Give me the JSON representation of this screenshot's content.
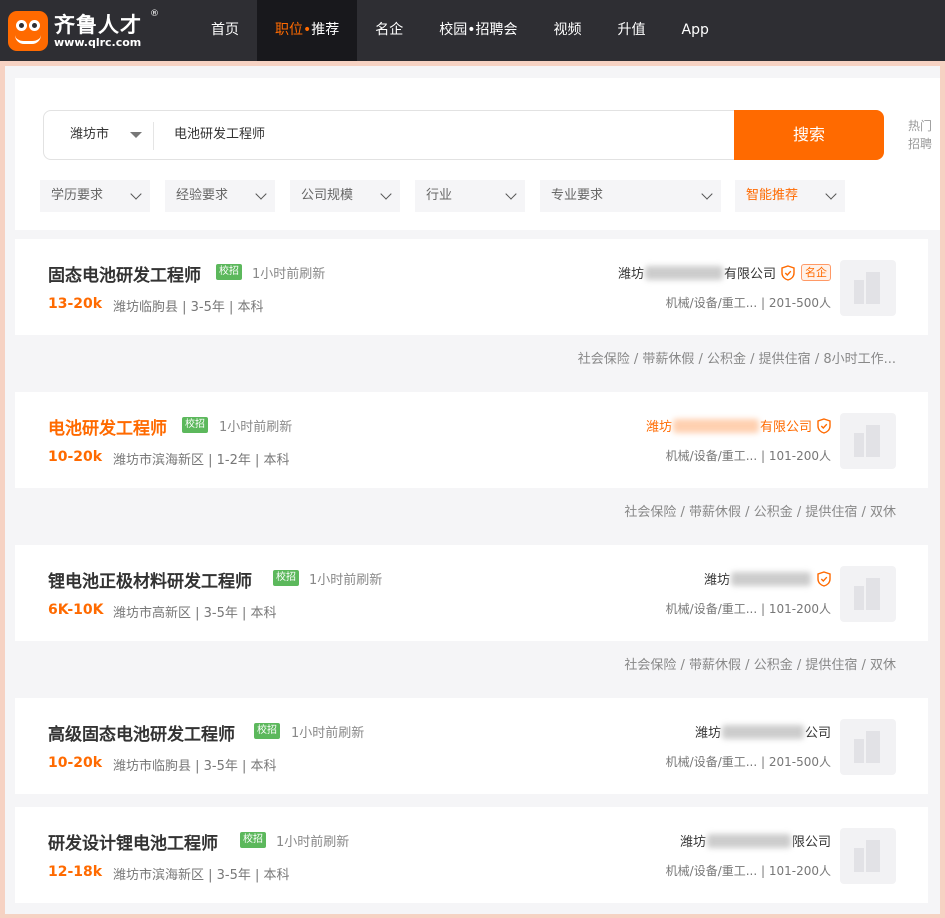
{
  "brand": {
    "name": "齐鲁人才",
    "reg": "®",
    "url": "www.qlrc.com"
  },
  "nav": [
    {
      "label": "首页"
    },
    {
      "label": "职位",
      "sep": "•",
      "second": "推荐",
      "active": true
    },
    {
      "label": "名企"
    },
    {
      "label": "校园•招聘会"
    },
    {
      "label": "视频"
    },
    {
      "label": "升值"
    },
    {
      "label": "App"
    }
  ],
  "search": {
    "city": "潍坊市",
    "keyword": "电池研发工程师",
    "button": "搜索",
    "hot_line1": "热门",
    "hot_line2": "招聘"
  },
  "filters": [
    "学历要求",
    "经验要求",
    "公司规模",
    "行业",
    "专业要求",
    "智能推荐"
  ],
  "jobs": [
    {
      "title": "固态电池研发工程师",
      "badge": "校招",
      "refresh": "1小时前刷新",
      "salary": "13-20k",
      "meta": "潍坊临朐县  |  3-5年  |  本科",
      "company_prefix": "潍坊",
      "company_suffix": "有限公司",
      "famous": "名企",
      "company_info": "机械/设备/重工...  | 201-500人",
      "welfare": "社会保险 / 带薪休假 / 公积金 / 提供住宿 / 8小时工作..."
    },
    {
      "title": "电池研发工程师",
      "badge": "校招",
      "refresh": "1小时前刷新",
      "salary": "10-20k",
      "meta": "潍坊市滨海新区  |  1-2年  |  本科",
      "company_prefix": "潍坊",
      "company_suffix": "有限公司",
      "company_info": "机械/设备/重工...  | 101-200人",
      "welfare": "社会保险 / 带薪休假 / 公积金 / 提供住宿 / 双休"
    },
    {
      "title": "锂电池正极材料研发工程师",
      "badge": "校招",
      "refresh": "1小时前刷新",
      "salary": "6K-10K",
      "meta": "潍坊市高新区  |  3-5年  |  本科",
      "company_prefix": "潍坊",
      "company_suffix": "",
      "company_info": "机械/设备/重工...  | 101-200人",
      "welfare": "社会保险 / 带薪休假 / 公积金 / 提供住宿 / 双休"
    },
    {
      "title": "高级固态电池研发工程师",
      "badge": "校招",
      "refresh": "1小时前刷新",
      "salary": "10-20k",
      "meta": "潍坊市临朐县  |  3-5年  |  本科",
      "company_prefix": "潍坊",
      "company_suffix": "公司",
      "company_info": "机械/设备/重工...  | 201-500人"
    },
    {
      "title": "研发设计锂电池工程师",
      "badge": "校招",
      "refresh": "1小时前刷新",
      "salary": "12-18k",
      "meta": "潍坊市滨海新区  |  3-5年  |  本科",
      "company_prefix": "潍坊",
      "company_suffix": "限公司",
      "company_info": "机械/设备/重工...  | 101-200人"
    }
  ],
  "colors": {
    "accent": "#ff6a00",
    "nav_bg": "#2e2e33",
    "badge_green": "#5cb85c"
  },
  "icons": [
    "verified-shield-icon",
    "chevron-down-icon",
    "caret-down-icon",
    "company-logo-placeholder-icon"
  ]
}
